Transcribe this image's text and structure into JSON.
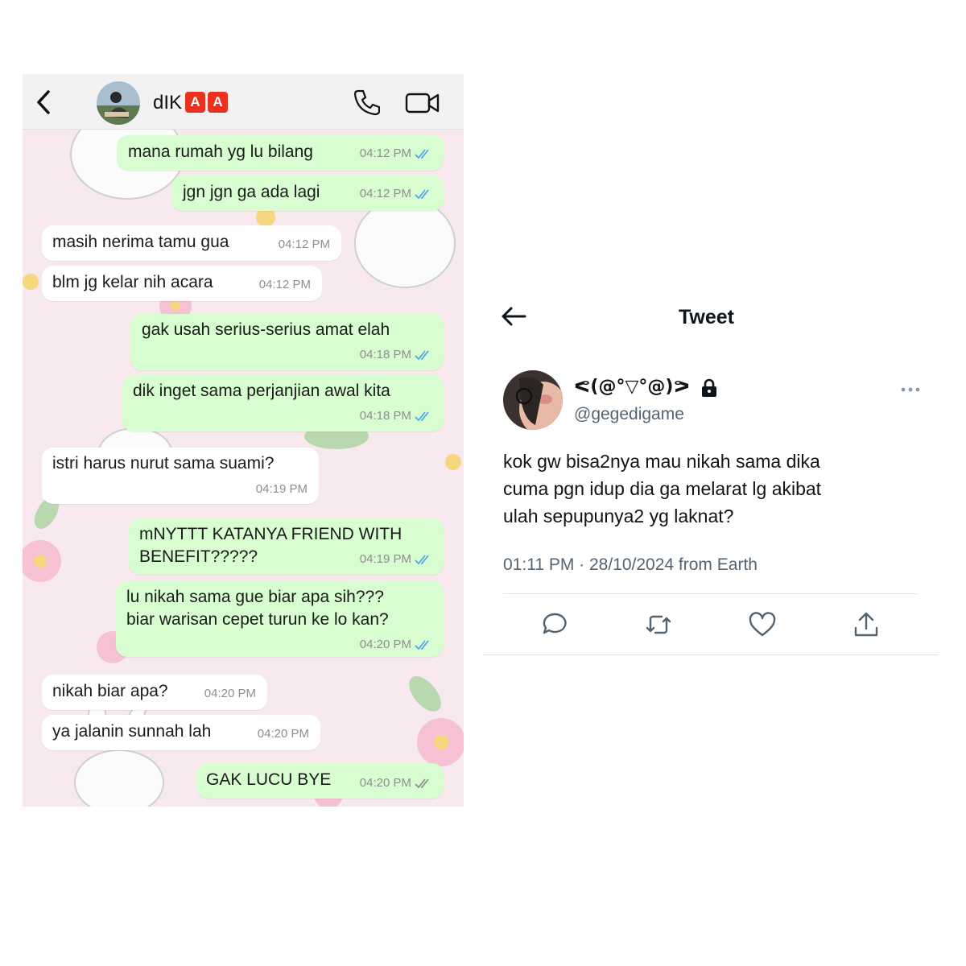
{
  "chat": {
    "contact_name": "dIK",
    "badges": [
      "A",
      "A"
    ],
    "messages": [
      {
        "dir": "out",
        "text": "mana rumah yg lu bilang",
        "time": "04:12 PM",
        "status": "read"
      },
      {
        "dir": "out",
        "text": "jgn jgn ga ada lagi",
        "time": "04:12 PM",
        "status": "read"
      },
      {
        "dir": "in",
        "text": "masih nerima tamu gua",
        "time": "04:12 PM"
      },
      {
        "dir": "in",
        "text": "blm jg kelar nih acara",
        "time": "04:12 PM"
      },
      {
        "dir": "out",
        "text": "gak usah serius-serius amat elah",
        "time": "04:18 PM",
        "status": "read"
      },
      {
        "dir": "out",
        "text": "dik inget sama perjanjian awal kita",
        "time": "04:18 PM",
        "status": "read"
      },
      {
        "dir": "in",
        "text": "istri harus nurut sama suami?",
        "time": "04:19 PM"
      },
      {
        "dir": "out",
        "text": "mNYTTT KATANYA FRIEND WITH\nBENEFIT?????",
        "time": "04:19 PM",
        "status": "read"
      },
      {
        "dir": "out",
        "text": "lu nikah sama gue biar apa sih???\nbiar warisan cepet turun ke lo kan?",
        "time": "04:20 PM",
        "status": "read"
      },
      {
        "dir": "in",
        "text": "nikah biar apa?",
        "time": "04:20 PM"
      },
      {
        "dir": "in",
        "text": "ya jalanin sunnah lah",
        "time": "04:20 PM"
      },
      {
        "dir": "out",
        "text": "GAK LUCU BYE",
        "time": "04:20 PM",
        "status": "delivered"
      }
    ],
    "colors": {
      "outgoing": "#d8fdd0",
      "incoming": "#ffffff",
      "read_ticks": "#4fa9e8",
      "delivered_ticks": "#8e8e8e",
      "badge": "#e8321f"
    }
  },
  "tweet": {
    "title": "Tweet",
    "display_name": "ᕙ(@°▽°@)ᕗ",
    "handle": "@gegedigame",
    "text_lines": [
      "kok gw bisa2nya mau nikah sama dika",
      "cuma pgn idup dia ga melarat lg akibat",
      "ulah sepupunya2 yg laknat?"
    ],
    "timestamp": "01:11 PM · 28/10/2024 from Earth",
    "actions": [
      "reply-icon",
      "retweet-icon",
      "like-icon",
      "share-icon"
    ],
    "colors": {
      "text": "#0f1419",
      "secondary": "#536471"
    }
  }
}
